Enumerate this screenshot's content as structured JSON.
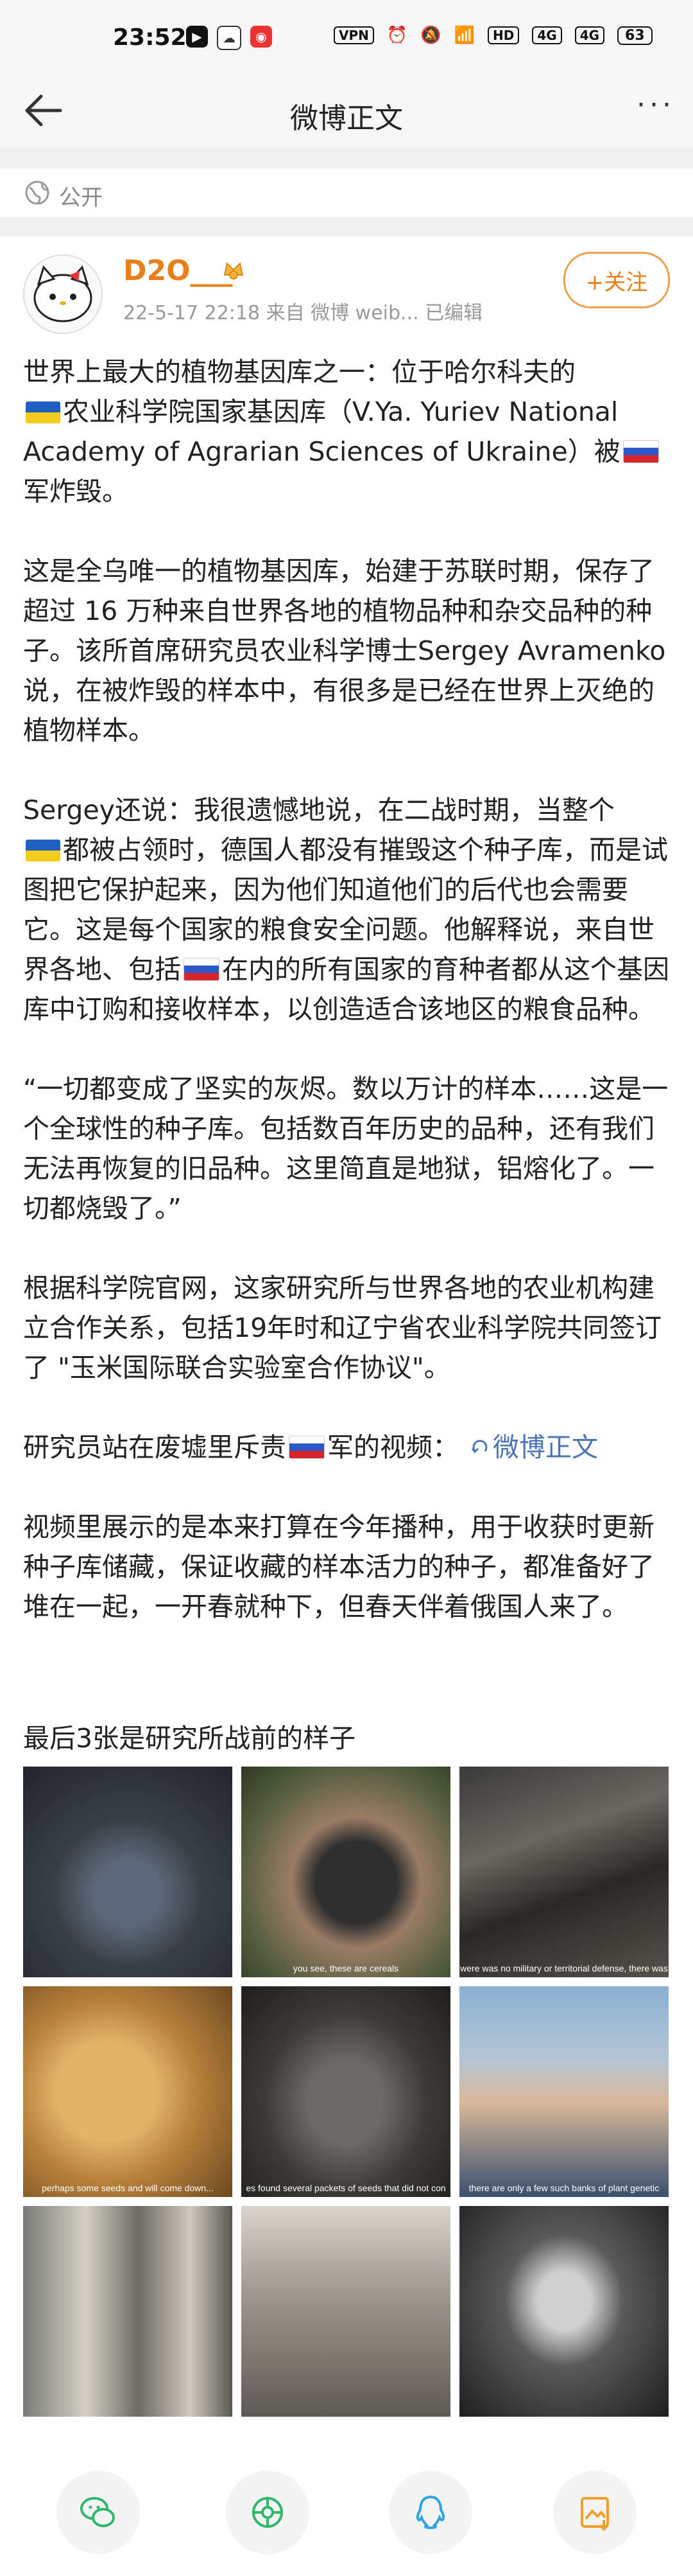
{
  "status_bar": {
    "time": "23:52",
    "vpn": "VPN",
    "hd": "HD",
    "sig1": "4G",
    "sig2": "4G",
    "battery": "63"
  },
  "nav": {
    "title": "微博正文",
    "more": "···"
  },
  "visibility": {
    "label": "公开"
  },
  "author": {
    "name": "D2O___",
    "meta": "22-5-17 22:18  来自 微博 weib...   已编辑",
    "follow_label": "+关注"
  },
  "post": {
    "p1_a": "世界上最大的植物基因库之一：位于哈尔科夫的",
    "p1_b": "农业科学院国家基因库（V.Ya. Yuriev National Academy of Agrarian Sciences of Ukraine）被",
    "p1_c": "军炸毁。",
    "p2": "这是全乌唯一的植物基因库，始建于苏联时期，保存了超过 16 万种来自世界各地的植物品种和杂交品种的种子。该所首席研究员农业科学博士Sergey Avramenko说，在被炸毁的样本中，有很多是已经在世界上灭绝的植物样本。",
    "p3_a": "Sergey还说：我很遗憾地说，在二战时期，当整个",
    "p3_b": "都被占领时，德国人都没有摧毁这个种子库，而是试图把它保护起来，因为他们知道他们的后代也会需要它。这是每个国家的粮食安全问题。他解释说，来自世界各地、包括",
    "p3_c": "在内的所有国家的育种者都从这个基因库中订购和接收样本，以创造适合该地区的粮食品种。",
    "p4": "“一切都变成了坚实的灰烬。数以万计的样本……这是一个全球性的种子库。包括数百年历史的品种，还有我们无法再恢复的旧品种。这里简直是地狱，铝熔化了。一切都烧毁了。”",
    "p5": "根据科学院官网，这家研究所与世界各地的农业机构建立合作关系，包括19年时和辽宁省农业科学院共同签订了 \"玉米国际联合实验室合作协议\"。",
    "p6_a": "研究员站在废墟里斥责",
    "p6_b": "军的视频：",
    "p6_link": "微博正文",
    "p7": "视频里展示的是本来打算在今年播种，用于收获时更新种子库储藏，保证收藏的样本活力的种子，都准备好了堆在一起，一开春就种下，但春天伴着俄国人来了。",
    "caption": "最后3张是研究所战前的样子"
  },
  "images": [
    {
      "name": "photo-burned-hall",
      "subtitle": ""
    },
    {
      "name": "photo-seeds-in-hand",
      "subtitle": "you see, these are cereals"
    },
    {
      "name": "photo-burned-room",
      "subtitle": "were was no military or territorial defense, there was"
    },
    {
      "name": "photo-grain-pile",
      "subtitle": "perhaps some seeds and will come down..."
    },
    {
      "name": "photo-seed-packets-ash",
      "subtitle": "es found several packets of seeds that did not con"
    },
    {
      "name": "photo-researcher-portrait",
      "subtitle": "there are only a few such banks of plant genetic"
    },
    {
      "name": "photo-archive-shelves",
      "subtitle": ""
    },
    {
      "name": "photo-storage-room",
      "subtitle": ""
    },
    {
      "name": "photo-seed-jar",
      "subtitle": ""
    }
  ],
  "share_bar": {
    "items": [
      "wechat-share-icon",
      "moments-share-icon",
      "qq-share-icon",
      "save-image-icon"
    ]
  }
}
